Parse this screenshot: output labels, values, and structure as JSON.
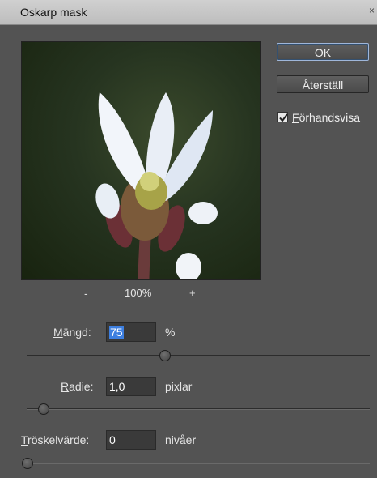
{
  "window": {
    "title": "Oskarp mask",
    "close_glyph": "×"
  },
  "buttons": {
    "ok": "OK",
    "reset": "Återställ"
  },
  "preview_toggle": {
    "label_rest": "örhandsvisa",
    "label_ul": "F",
    "checked": true
  },
  "zoom": {
    "minus": "-",
    "value": "100%",
    "plus": "+"
  },
  "amount": {
    "label_ul": "M",
    "label_rest": "ängd:",
    "value": "75",
    "unit": "%",
    "level": 0.4
  },
  "radius": {
    "label_ul": "R",
    "label_rest": "adie:",
    "value": "1,0",
    "unit": "pixlar",
    "level": 0.04
  },
  "threshold": {
    "label_ul": "T",
    "label_rest": "röskelvärde:",
    "value": "0",
    "unit": "nivåer",
    "level": 0.0
  },
  "colors": {
    "panel": "#535353",
    "selection": "#3d7fe0",
    "title_bar": "#c8c8c8"
  }
}
